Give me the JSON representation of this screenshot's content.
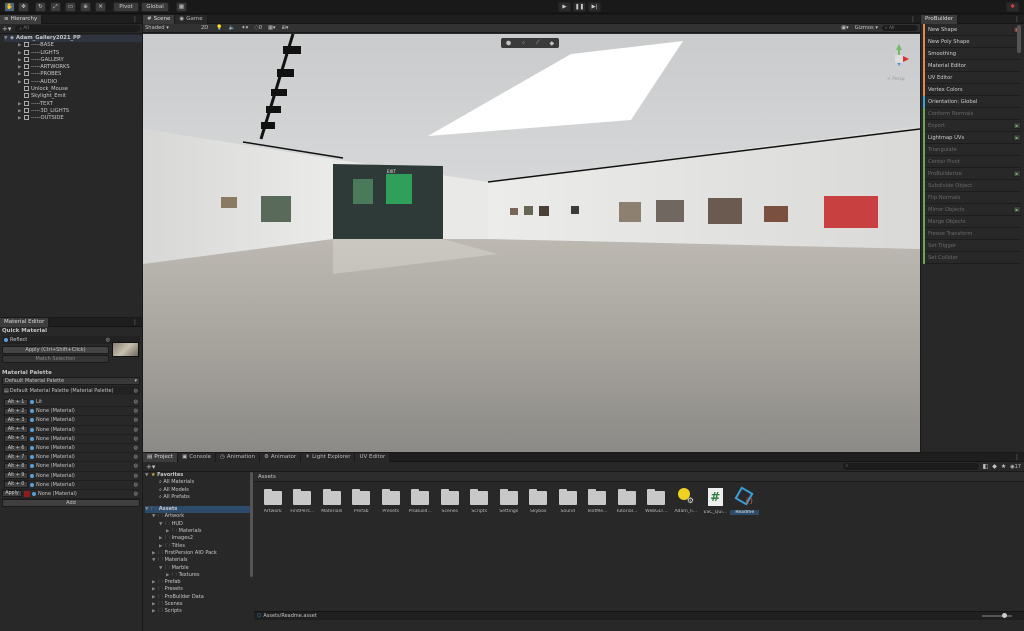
{
  "toolbar": {
    "pivot_label": "Pivot",
    "global_label": "Global"
  },
  "hierarchy": {
    "tab": "Hierarchy",
    "search_placeholder": "All",
    "root": "Adam_Gallery2021_PP",
    "items": [
      {
        "label": "-----BASE",
        "expandable": true
      },
      {
        "label": "-----LIGHTS",
        "expandable": true
      },
      {
        "label": "-----GALLERY",
        "expandable": true
      },
      {
        "label": "-----ARTWORKS",
        "expandable": true
      },
      {
        "label": "-----PROBES",
        "expandable": true
      },
      {
        "label": "-----AUDIO",
        "expandable": true
      },
      {
        "label": "Unlock_Mouse",
        "expandable": false
      },
      {
        "label": "Skylight_Emit",
        "expandable": false
      },
      {
        "label": "-----TEXT",
        "expandable": true
      },
      {
        "label": "-----3D_LIGHTS",
        "expandable": true
      },
      {
        "label": "-----OUTSIDE",
        "expandable": true
      }
    ]
  },
  "scene": {
    "tabs": [
      "Scene",
      "Game"
    ],
    "shading": "Shaded",
    "mode_2d": "2D",
    "layers_count": "0",
    "gizmos_label": "Gizmos",
    "search_placeholder": "All",
    "persp_label": "< Persp",
    "exit_sign": "EXIT"
  },
  "probuilder": {
    "tab": "ProBuilder",
    "items": [
      {
        "label": "New Shape",
        "color": "#e08a4a",
        "enabled": true,
        "gear": true
      },
      {
        "label": "New Poly Shape",
        "color": "#e08a4a",
        "enabled": true,
        "gear": false
      },
      {
        "label": "Smoothing",
        "color": "#e08a4a",
        "enabled": true,
        "gear": false
      },
      {
        "label": "Material Editor",
        "color": "#e08a4a",
        "enabled": true,
        "gear": false
      },
      {
        "label": "UV Editor",
        "color": "#e08a4a",
        "enabled": true,
        "gear": false
      },
      {
        "label": "Vertex Colors",
        "color": "#e08a4a",
        "enabled": true,
        "gear": false
      },
      {
        "label": "Orientation: Global",
        "color": "#3ba2c8",
        "enabled": true,
        "gear": false
      },
      {
        "label": "Conform Normals",
        "color": "#6aa84f",
        "enabled": false,
        "gear": false
      },
      {
        "label": "Export",
        "color": "#6aa84f",
        "enabled": false,
        "gear": true
      },
      {
        "label": "Lightmap UVs",
        "color": "#6aa84f",
        "enabled": true,
        "gear": true
      },
      {
        "label": "Triangulate",
        "color": "#6aa84f",
        "enabled": false,
        "gear": false
      },
      {
        "label": "Center Pivot",
        "color": "#6aa84f",
        "enabled": false,
        "gear": false
      },
      {
        "label": "ProBuilderize",
        "color": "#6aa84f",
        "enabled": false,
        "gear": true
      },
      {
        "label": "Subdivide Object",
        "color": "#6aa84f",
        "enabled": false,
        "gear": false
      },
      {
        "label": "Flip Normals",
        "color": "#6aa84f",
        "enabled": false,
        "gear": false
      },
      {
        "label": "Mirror Objects",
        "color": "#6aa84f",
        "enabled": false,
        "gear": true
      },
      {
        "label": "Merge Objects",
        "color": "#6aa84f",
        "enabled": false,
        "gear": false
      },
      {
        "label": "Freeze Transform",
        "color": "#6aa84f",
        "enabled": false,
        "gear": false
      },
      {
        "label": "Set Trigger",
        "color": "#6aa84f",
        "enabled": false,
        "gear": false
      },
      {
        "label": "Set Collider",
        "color": "#6aa84f",
        "enabled": false,
        "gear": false
      }
    ]
  },
  "material_editor": {
    "tab": "Material Editor",
    "quick_material": "Quick Material",
    "reflect": "Reflect",
    "apply_btn": "Apply (Ctrl+Shift+Click)",
    "match_btn": "Match Selection",
    "palette_title": "Material Palette",
    "palette_select": "Default Material Palette",
    "palette_asset": "Default Material Palette (Material Palette)",
    "rows": [
      {
        "key": "Alt + 1",
        "value": "Lit"
      },
      {
        "key": "Alt + 2",
        "value": "None (Material)"
      },
      {
        "key": "Alt + 3",
        "value": "None (Material)"
      },
      {
        "key": "Alt + 4",
        "value": "None (Material)"
      },
      {
        "key": "Alt + 5",
        "value": "None (Material)"
      },
      {
        "key": "Alt + 6",
        "value": "None (Material)"
      },
      {
        "key": "Alt + 7",
        "value": "None (Material)"
      },
      {
        "key": "Alt + 8",
        "value": "None (Material)"
      },
      {
        "key": "Alt + 9",
        "value": "None (Material)"
      },
      {
        "key": "Alt + 0",
        "value": "None (Material)"
      }
    ],
    "apply_row_btn": "Apply",
    "apply_row_value": "None (Material)",
    "add_btn": "Add"
  },
  "project": {
    "tabs": [
      "Project",
      "Console",
      "Animation",
      "Animator",
      "Light Explorer",
      "UV Editor"
    ],
    "favorites": "Favorites",
    "fav_items": [
      "All Materials",
      "All Models",
      "All Prefabs"
    ],
    "assets_root": "Assets",
    "tree": [
      {
        "label": "Artwork",
        "depth": 1,
        "open": true
      },
      {
        "label": "HUD",
        "depth": 2,
        "open": true
      },
      {
        "label": "Materials",
        "depth": 3,
        "open": false
      },
      {
        "label": "Images2",
        "depth": 2,
        "open": false
      },
      {
        "label": "Titles",
        "depth": 2,
        "open": false
      },
      {
        "label": "FirstPersion AIO Pack",
        "depth": 1,
        "open": false
      },
      {
        "label": "Materials",
        "depth": 1,
        "open": true
      },
      {
        "label": "Marble",
        "depth": 2,
        "open": true
      },
      {
        "label": "Textures",
        "depth": 3,
        "open": false
      },
      {
        "label": "Prefab",
        "depth": 1,
        "open": false
      },
      {
        "label": "Presets",
        "depth": 1,
        "open": false
      },
      {
        "label": "ProBuilder Data",
        "depth": 1,
        "open": false
      },
      {
        "label": "Scenes",
        "depth": 1,
        "open": false
      },
      {
        "label": "Scripts",
        "depth": 1,
        "open": false
      }
    ],
    "breadcrumb": "Assets",
    "assets": [
      {
        "label": "Artwork",
        "kind": "folder"
      },
      {
        "label": "FirstPers...",
        "kind": "folder"
      },
      {
        "label": "Materials",
        "kind": "folder"
      },
      {
        "label": "Prefab",
        "kind": "folder"
      },
      {
        "label": "Presets",
        "kind": "folder"
      },
      {
        "label": "ProBuild...",
        "kind": "folder"
      },
      {
        "label": "Scenes",
        "kind": "folder"
      },
      {
        "label": "Scripts",
        "kind": "folder"
      },
      {
        "label": "Settings",
        "kind": "folder"
      },
      {
        "label": "Skybox",
        "kind": "folder"
      },
      {
        "label": "Sound",
        "kind": "folder"
      },
      {
        "label": "TextMe...",
        "kind": "folder"
      },
      {
        "label": "Tutorial...",
        "kind": "folder"
      },
      {
        "label": "WebGLT...",
        "kind": "folder"
      },
      {
        "label": "Adam_li...",
        "kind": "lighting"
      },
      {
        "label": "ESC_Qui...",
        "kind": "script"
      },
      {
        "label": "Readme",
        "kind": "readme"
      }
    ],
    "status_path": "Assets/Readme.asset",
    "visible_count": "17",
    "script_glyph": "#"
  }
}
